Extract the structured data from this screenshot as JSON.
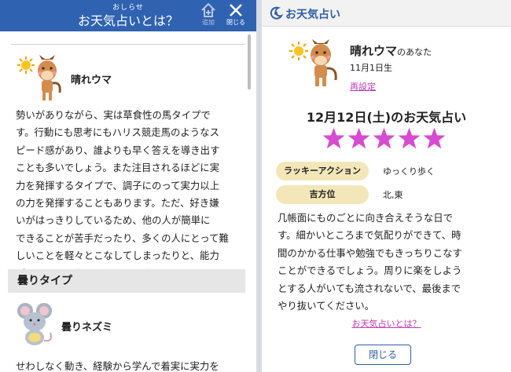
{
  "left": {
    "header": {
      "subtitle": "おしらせ",
      "title": "お天気占いとは？",
      "add_label": "追加",
      "close_label": "閉じる"
    },
    "type1": {
      "name": "晴れウマ",
      "lines": [
        "勢いがありながら、実は草食性の馬タイプで",
        "す。行動にも思考にもハリス競走馬のようなス",
        "ピード感があり、誰よりも早く答えを導き出す",
        "ことも多いでしょう。また注目されるほどに実",
        "力を発揮するタイプで、調子にのって実力以上",
        "の力を発揮することもあります。ただ、好き嫌",
        "いがはっきりしているため、他の人が簡単に",
        "できることが苦手だったり、多くの人にとって難",
        "しいことを軽々とこなしてしまったりと、能力",
        "がちぐはぐになったりもします。"
      ]
    },
    "section": "曇りタイプ",
    "type2": {
      "name": "曇りネズミ",
      "lines": [
        "せわしなく動き、経験から学んで着実に実力を"
      ]
    }
  },
  "right": {
    "header": {
      "title": "お天気占い"
    },
    "profile": {
      "name": "晴れウマ",
      "name_suffix": "のあなた",
      "birthday": "11月1日生",
      "reset": "再設定"
    },
    "date_title": "12月12日(土)のお天気占い",
    "rating": {
      "stars": 5,
      "max": 5
    },
    "lucky_label": "ラッキーアクション",
    "lucky_value": "ゆっくり歩く",
    "direction_label": "吉方位",
    "direction_value": "北,東",
    "fortune_lines": [
      "几帳面にものごとに向き合えそうな日で",
      "す。細かいところまで気配りができて、時",
      "間のかかる仕事や勉強でもきっちりこなす",
      "ことができるでしょう。周りに楽をしよう",
      "とする人がいても流されないで、最後まで",
      "やり抜いてください。"
    ],
    "about_link": "お天気占いとは？",
    "close_button": "閉じる"
  },
  "colors": {
    "header_blue": "#2f62b1",
    "accent_pink": "#c23ab6",
    "star": "#d74bd0",
    "pill": "#f3e7b9"
  },
  "icons": [
    "home-add-icon",
    "close-icon",
    "sun-icon",
    "horse-icon",
    "mouse-icon",
    "fortune-logo-icon",
    "star-icon"
  ]
}
